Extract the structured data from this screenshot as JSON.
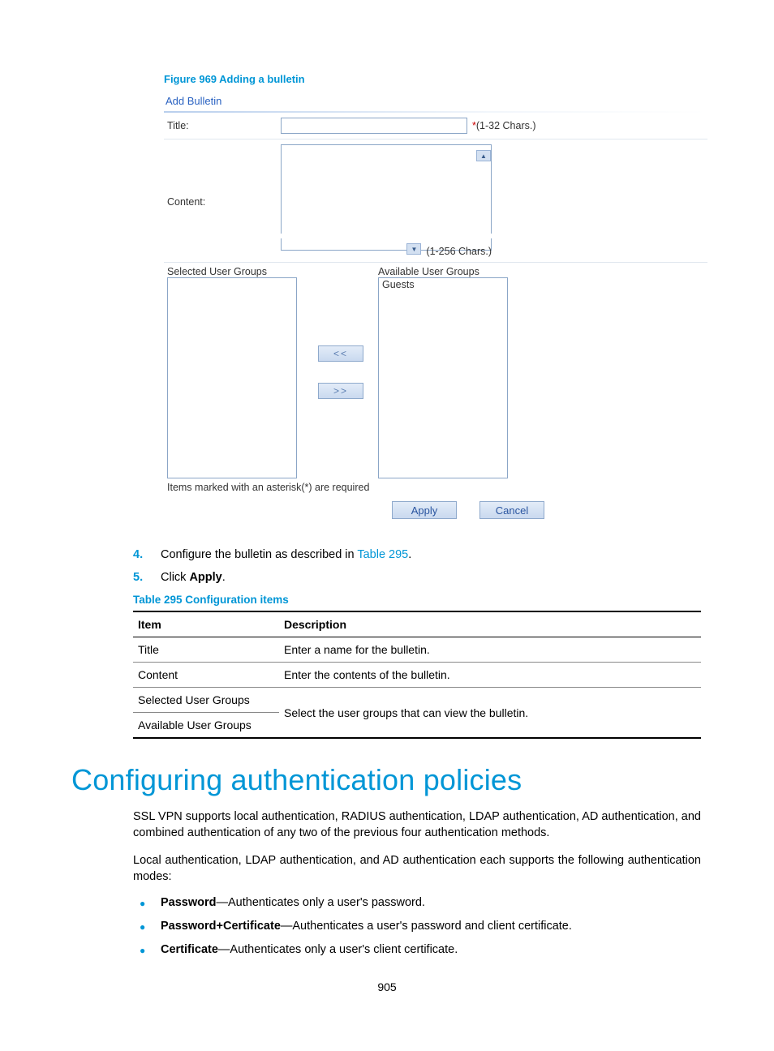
{
  "figure": {
    "caption": "Figure 969 Adding a bulletin"
  },
  "form": {
    "header": "Add Bulletin",
    "title_label": "Title:",
    "title_hint_star": "*",
    "title_hint": "(1-32 Chars.)",
    "content_label": "Content:",
    "content_hint": "(1-256 Chars.)",
    "selected_label": "Selected User Groups",
    "available_label": "Available User Groups",
    "available_items": [
      "Guests"
    ],
    "move_left": "<<",
    "move_right": ">>",
    "required_note": "Items marked with an asterisk(*) are required",
    "apply_label": "Apply",
    "cancel_label": "Cancel"
  },
  "steps": [
    {
      "num": "4.",
      "prefix": "Configure the bulletin as described in ",
      "link": "Table 295",
      "suffix": "."
    },
    {
      "num": "5.",
      "prefix": "Click ",
      "strong": "Apply",
      "suffix": "."
    }
  ],
  "table": {
    "caption": "Table 295 Configuration items",
    "head_item": "Item",
    "head_desc": "Description",
    "rows": {
      "r1_item": "Title",
      "r1_desc": "Enter a name for the bulletin.",
      "r2_item": "Content",
      "r2_desc": "Enter the contents of the bulletin.",
      "r3_item": "Selected User Groups",
      "r4_item": "Available User Groups",
      "r34_desc": "Select the user groups that can view the bulletin."
    }
  },
  "heading": "Configuring authentication policies",
  "para1": "SSL VPN supports local authentication, RADIUS authentication, LDAP authentication, AD authentication, and combined authentication of any two of the previous four authentication methods.",
  "para2": "Local authentication, LDAP authentication, and AD authentication each supports the following authentication modes:",
  "bullets": [
    {
      "strong": "Password",
      "rest": "—Authenticates only a user's password."
    },
    {
      "strong": "Password+Certificate",
      "rest": "—Authenticates a user's password and client certificate."
    },
    {
      "strong": "Certificate",
      "rest": "—Authenticates only a user's client certificate."
    }
  ],
  "page_number": "905"
}
